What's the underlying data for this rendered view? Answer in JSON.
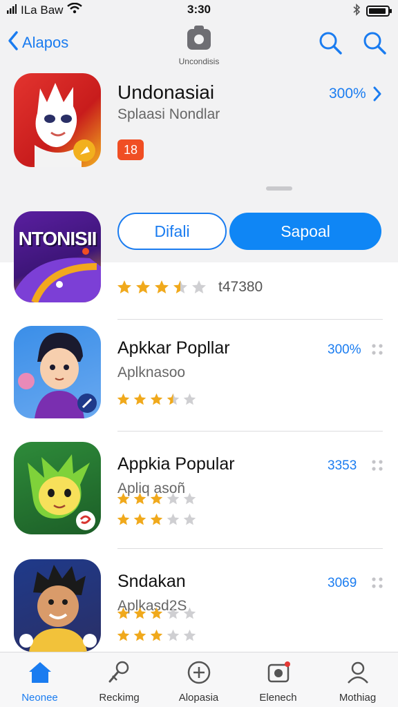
{
  "status": {
    "carrier": "ILa Baw",
    "time": "3:30",
    "right_icons": [
      "bluetooth-icon",
      "battery-icon"
    ]
  },
  "nav": {
    "back_label": "Alapos",
    "center_label": "Uncondisis",
    "icons": [
      "search-icon",
      "search-icon"
    ]
  },
  "featured": {
    "title": "Undonasiai",
    "subtitle": "Splaasi Nondlar",
    "age_badge": "18",
    "percent": "300%"
  },
  "second_app": {
    "icon_text": "NTONISII",
    "detail_button": "Difali",
    "primary_button": "Sapoal",
    "rating": 3.5,
    "rating_count": "t47380"
  },
  "apps": [
    {
      "title": "Apkkar Popllar",
      "subtitle": "Aplknasoo",
      "percent": "300%",
      "rating": 3.5,
      "rating2": null
    },
    {
      "title": "Appkia Popular",
      "subtitle": "Apliq asoñ",
      "percent": "3353",
      "rating": 3,
      "rating2": 3
    },
    {
      "title": "Sndakan",
      "subtitle": "Aplkasd2S",
      "percent": "3069",
      "rating": 3,
      "rating2": 3
    }
  ],
  "tabs": [
    {
      "label": "Neonee",
      "icon": "home-icon",
      "active": true
    },
    {
      "label": "Reckimg",
      "icon": "ranking-icon",
      "active": false
    },
    {
      "label": "Alopasia",
      "icon": "add-icon",
      "active": false
    },
    {
      "label": "Elenech",
      "icon": "camera-badge-icon",
      "active": false
    },
    {
      "label": "Mothiag",
      "icon": "profile-icon",
      "active": false
    }
  ],
  "colors": {
    "accent": "#1a7cf0",
    "star_full": "#f0a91c",
    "star_empty": "#cfcfd2",
    "age_badge": "#f04e23"
  }
}
